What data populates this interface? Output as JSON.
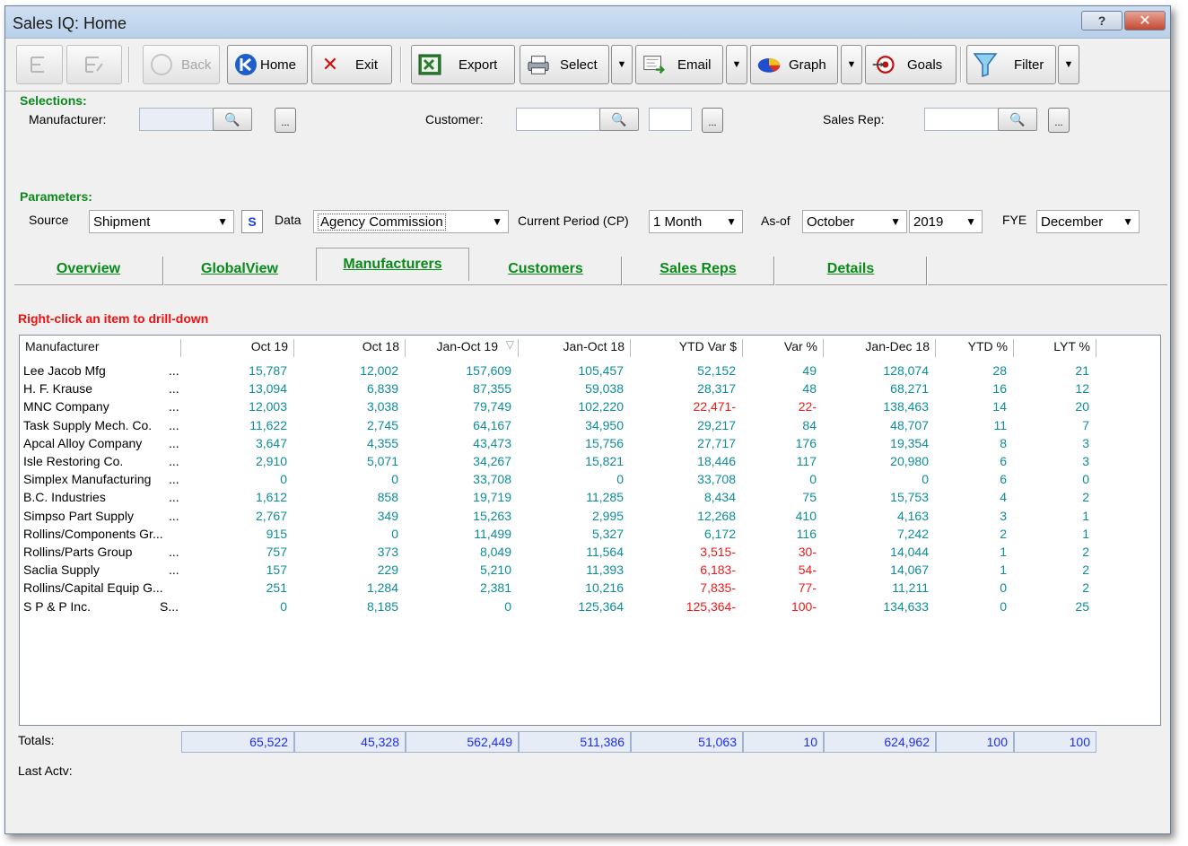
{
  "window": {
    "title": "Sales IQ: Home",
    "help_label": "?",
    "close_label": "✕"
  },
  "toolbar": {
    "back_label": "Back",
    "home_label": "Home",
    "exit_label": "Exit",
    "export_label": "Export",
    "select_label": "Select",
    "email_label": "Email",
    "graph_label": "Graph",
    "goals_label": "Goals",
    "filter_label": "Filter"
  },
  "selections": {
    "heading": "Selections:",
    "manufacturer_label": "Manufacturer:",
    "customer_label": "Customer:",
    "sales_rep_label": "Sales Rep:",
    "manufacturer_value": "",
    "customer_value": "",
    "customer_extra_value": "",
    "sales_rep_value": "",
    "dots_label": "...",
    "binoculars_glyph": "🔍"
  },
  "parameters": {
    "heading": "Parameters:",
    "source_label": "Source",
    "source_value": "Shipment",
    "s_label": "S",
    "data_label": "Data",
    "data_value": "Agency Commission",
    "current_period_label": "Current Period (CP)",
    "current_period_value": "1 Month",
    "as_of_label": "As-of",
    "as_of_month": "October",
    "as_of_year": "2019",
    "fye_label": "FYE",
    "fye_value": "December"
  },
  "tabs": [
    {
      "label": "Overview"
    },
    {
      "label": "GlobalView"
    },
    {
      "label": "Manufacturers"
    },
    {
      "label": "Customers"
    },
    {
      "label": "Sales Reps"
    },
    {
      "label": "Details"
    }
  ],
  "hint": "Right-click an item to drill-down",
  "table": {
    "columns": [
      "Manufacturer",
      "Oct 19",
      "Oct 18",
      "Jan-Oct 19",
      "Jan-Oct 18",
      "YTD Var $",
      "Var %",
      "Jan-Dec 18",
      "YTD %",
      "LYT %"
    ],
    "rows": [
      {
        "name": "Lee Jacob Mfg",
        "tag": "...",
        "oct19": "15,787",
        "oct18": "12,002",
        "ytd19": "157,609",
        "ytd18": "105,457",
        "var": "52,152",
        "varp": "49",
        "fy18": "128,074",
        "ytdp": "28",
        "lytp": "21",
        "neg": false
      },
      {
        "name": "H. F. Krause",
        "tag": "...",
        "oct19": "13,094",
        "oct18": "6,839",
        "ytd19": "87,355",
        "ytd18": "59,038",
        "var": "28,317",
        "varp": "48",
        "fy18": "68,271",
        "ytdp": "16",
        "lytp": "12",
        "neg": false
      },
      {
        "name": "MNC Company",
        "tag": "...",
        "oct19": "12,003",
        "oct18": "3,038",
        "ytd19": "79,749",
        "ytd18": "102,220",
        "var": "22,471-",
        "varp": "22-",
        "fy18": "138,463",
        "ytdp": "14",
        "lytp": "20",
        "neg": true
      },
      {
        "name": "Task Supply Mech. Co.",
        "tag": "...",
        "oct19": "11,622",
        "oct18": "2,745",
        "ytd19": "64,167",
        "ytd18": "34,950",
        "var": "29,217",
        "varp": "84",
        "fy18": "48,707",
        "ytdp": "11",
        "lytp": "7",
        "neg": false
      },
      {
        "name": "Apcal Alloy Company",
        "tag": "...",
        "oct19": "3,647",
        "oct18": "4,355",
        "ytd19": "43,473",
        "ytd18": "15,756",
        "var": "27,717",
        "varp": "176",
        "fy18": "19,354",
        "ytdp": "8",
        "lytp": "3",
        "neg": false
      },
      {
        "name": "Isle Restoring Co.",
        "tag": "...",
        "oct19": "2,910",
        "oct18": "5,071",
        "ytd19": "34,267",
        "ytd18": "15,821",
        "var": "18,446",
        "varp": "117",
        "fy18": "20,980",
        "ytdp": "6",
        "lytp": "3",
        "neg": false
      },
      {
        "name": "Simplex Manufacturing",
        "tag": "...",
        "oct19": "0",
        "oct18": "0",
        "ytd19": "33,708",
        "ytd18": "0",
        "var": "33,708",
        "varp": "0",
        "fy18": "0",
        "ytdp": "6",
        "lytp": "0",
        "neg": false
      },
      {
        "name": "B.C. Industries",
        "tag": "...",
        "oct19": "1,612",
        "oct18": "858",
        "ytd19": "19,719",
        "ytd18": "11,285",
        "var": "8,434",
        "varp": "75",
        "fy18": "15,753",
        "ytdp": "4",
        "lytp": "2",
        "neg": false
      },
      {
        "name": "Simpso Part Supply",
        "tag": "...",
        "oct19": "2,767",
        "oct18": "349",
        "ytd19": "15,263",
        "ytd18": "2,995",
        "var": "12,268",
        "varp": "410",
        "fy18": "4,163",
        "ytdp": "3",
        "lytp": "1",
        "neg": false
      },
      {
        "name": "Rollins/Components Gr...",
        "tag": "",
        "oct19": "915",
        "oct18": "0",
        "ytd19": "11,499",
        "ytd18": "5,327",
        "var": "6,172",
        "varp": "116",
        "fy18": "7,242",
        "ytdp": "2",
        "lytp": "1",
        "neg": false
      },
      {
        "name": "Rollins/Parts Group",
        "tag": "...",
        "oct19": "757",
        "oct18": "373",
        "ytd19": "8,049",
        "ytd18": "11,564",
        "var": "3,515-",
        "varp": "30-",
        "fy18": "14,044",
        "ytdp": "1",
        "lytp": "2",
        "neg": true
      },
      {
        "name": "Saclia Supply",
        "tag": "...",
        "oct19": "157",
        "oct18": "229",
        "ytd19": "5,210",
        "ytd18": "11,393",
        "var": "6,183-",
        "varp": "54-",
        "fy18": "14,067",
        "ytdp": "1",
        "lytp": "2",
        "neg": true
      },
      {
        "name": "Rollins/Capital Equip G...",
        "tag": "",
        "oct19": "251",
        "oct18": "1,284",
        "ytd19": "2,381",
        "ytd18": "10,216",
        "var": "7,835-",
        "varp": "77-",
        "fy18": "11,211",
        "ytdp": "0",
        "lytp": "2",
        "neg": true
      },
      {
        "name": "S P & P Inc.",
        "tag": "S...",
        "oct19": "0",
        "oct18": "8,185",
        "ytd19": "0",
        "ytd18": "125,364",
        "var": "125,364-",
        "varp": "100-",
        "fy18": "134,633",
        "ytdp": "0",
        "lytp": "25",
        "neg": true
      }
    ]
  },
  "totals": {
    "label": "Totals:",
    "values": [
      "65,522",
      "45,328",
      "562,449",
      "511,386",
      "51,063",
      "10",
      "624,962",
      "100",
      "100"
    ]
  },
  "last_activity_label": "Last Actv:",
  "colors": {
    "positive": "#0d8c9a",
    "negative": "#ee1a1a",
    "section": "#0a8a1a",
    "totals": "#1f2fe8"
  }
}
